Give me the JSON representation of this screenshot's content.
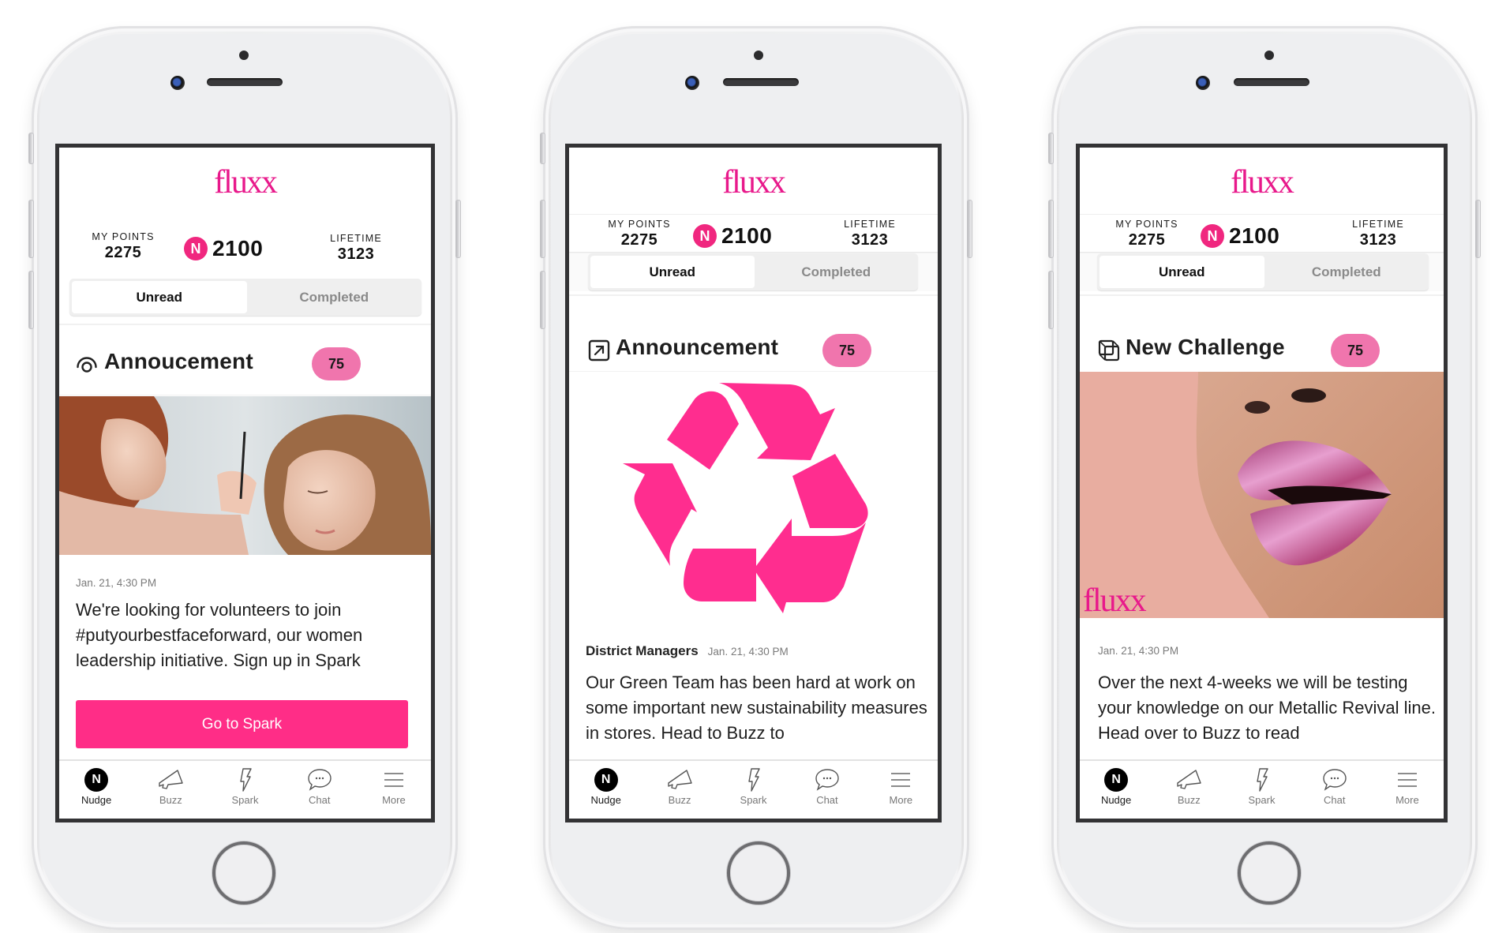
{
  "app": {
    "brand": "fluxx",
    "colors": {
      "brand_pink": "#e8198b",
      "badge_pink": "#f075ad",
      "cta_pink": "#ff2d87",
      "nudge_badge": "#f0277f"
    }
  },
  "phones": [
    {
      "header": {
        "logo": "fluxx",
        "my_points_label": "MY POINTS",
        "my_points_value": "2275",
        "nudge_badge": "N",
        "nudge_value": "2100",
        "lifetime_label": "LIFETIME",
        "lifetime_value": "3123"
      },
      "tabs": [
        {
          "label": "Unread",
          "active": true
        },
        {
          "label": "Completed",
          "active": false
        }
      ],
      "card": {
        "icon": "radar-icon",
        "title": "Annoucement",
        "points": "75",
        "image": "makeup-artist-photo",
        "date": "Jan. 21, 4:30 PM",
        "body": "We're looking for volunteers to join #putyourbestfaceforward, our women leadership initiative. Sign up in Spark",
        "cta_label": "Go to Spark"
      },
      "tabbar": [
        {
          "label": "Nudge",
          "icon": "nudge-icon",
          "active": true
        },
        {
          "label": "Buzz",
          "icon": "megaphone-icon",
          "active": false
        },
        {
          "label": "Spark",
          "icon": "lightning-icon",
          "active": false
        },
        {
          "label": "Chat",
          "icon": "chat-bubble-icon",
          "active": false
        },
        {
          "label": "More",
          "icon": "menu-icon",
          "active": false
        }
      ]
    },
    {
      "header": {
        "logo": "fluxx",
        "my_points_label": "MY POINTS",
        "my_points_value": "2275",
        "nudge_badge": "N",
        "nudge_value": "2100",
        "lifetime_label": "LIFETIME",
        "lifetime_value": "3123"
      },
      "tabs": [
        {
          "label": "Unread",
          "active": true
        },
        {
          "label": "Completed",
          "active": false
        }
      ],
      "card": {
        "icon": "external-link-icon",
        "title": "Announcement",
        "points": "75",
        "image": "recycle-symbol",
        "author": "District Managers",
        "date": "Jan. 21, 4:30 PM",
        "body": "Our Green Team has been hard at work on some important new sustainability measures in stores. Head to Buzz to"
      },
      "tabbar": [
        {
          "label": "Nudge",
          "icon": "nudge-icon",
          "active": true
        },
        {
          "label": "Buzz",
          "icon": "megaphone-icon",
          "active": false
        },
        {
          "label": "Spark",
          "icon": "lightning-icon",
          "active": false
        },
        {
          "label": "Chat",
          "icon": "chat-bubble-icon",
          "active": false
        },
        {
          "label": "More",
          "icon": "menu-icon",
          "active": false
        }
      ]
    },
    {
      "header": {
        "logo": "fluxx",
        "my_points_label": "MY POINTS",
        "my_points_value": "2275",
        "nudge_badge": "N",
        "nudge_value": "2100",
        "lifetime_label": "LIFETIME",
        "lifetime_value": "3123"
      },
      "tabs": [
        {
          "label": "Unread",
          "active": true
        },
        {
          "label": "Completed",
          "active": false
        }
      ],
      "card": {
        "icon": "overlapping-squares-icon",
        "title": "New Challenge",
        "points": "75",
        "image": "metallic-lips-photo",
        "image_overlay_text": "fluxx",
        "date": "Jan. 21, 4:30 PM",
        "body": "Over the next 4-weeks we will be testing your knowledge on our Metallic Revival line. Head over to Buzz to read"
      },
      "tabbar": [
        {
          "label": "Nudge",
          "icon": "nudge-icon",
          "active": true
        },
        {
          "label": "Buzz",
          "icon": "megaphone-icon",
          "active": false
        },
        {
          "label": "Spark",
          "icon": "lightning-icon",
          "active": false
        },
        {
          "label": "Chat",
          "icon": "chat-bubble-icon",
          "active": false
        },
        {
          "label": "More",
          "icon": "menu-icon",
          "active": false
        }
      ]
    }
  ]
}
